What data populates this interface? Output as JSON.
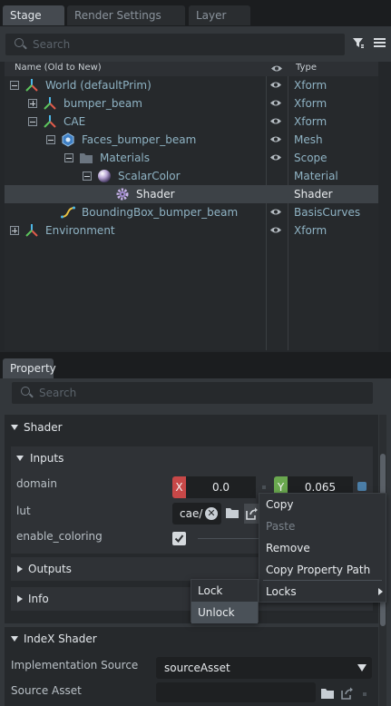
{
  "stage_panel": {
    "tabs": [
      {
        "label": "Stage",
        "active": true
      },
      {
        "label": "Render Settings",
        "active": false
      },
      {
        "label": "Layer",
        "active": false
      }
    ],
    "search_placeholder": "Search",
    "columns": {
      "name": "Name (Old to New)",
      "type": "Type"
    },
    "tree": [
      {
        "name": "World (defaultPrim)",
        "type": "Xform",
        "icon": "xform-icon",
        "expander": "minus",
        "visible": true,
        "selected": false
      },
      {
        "name": "bumper_beam",
        "type": "Xform",
        "icon": "xform-icon",
        "expander": "plus",
        "visible": true,
        "selected": false
      },
      {
        "name": "CAE",
        "type": "Xform",
        "icon": "xform-icon",
        "expander": "minus",
        "visible": true,
        "selected": false
      },
      {
        "name": "Faces_bumper_beam",
        "type": "Mesh",
        "icon": "mesh-icon",
        "expander": "minus",
        "visible": true,
        "selected": false
      },
      {
        "name": "Materials",
        "type": "Scope",
        "icon": "folder-icon",
        "expander": "minus",
        "visible": true,
        "selected": false
      },
      {
        "name": "ScalarColor",
        "type": "Material",
        "icon": "material-sphere-icon",
        "expander": "minus",
        "visible": false,
        "selected": false
      },
      {
        "name": "Shader",
        "type": "Shader",
        "icon": "shader-gear-icon",
        "expander": "none",
        "visible": false,
        "selected": true
      },
      {
        "name": "BoundingBox_bumper_beam",
        "type": "BasisCurves",
        "icon": "curve-icon",
        "expander": "none",
        "visible": true,
        "selected": false
      },
      {
        "name": "Environment",
        "type": "Xform",
        "icon": "xform-icon",
        "expander": "plus",
        "visible": true,
        "selected": false
      }
    ]
  },
  "property_panel": {
    "tab": "Property",
    "search_placeholder": "Search",
    "shader_section": "Shader",
    "inputs_section": "Inputs",
    "domain": {
      "label": "domain",
      "x_label": "X",
      "x_value": "0.0",
      "y_label": "Y",
      "y_value": "0.065"
    },
    "lut": {
      "label": "lut",
      "value": "cae/"
    },
    "enable_coloring": {
      "label": "enable_coloring",
      "checked": true
    },
    "outputs_section": "Outputs",
    "info_section": "Info",
    "index_shader_section": "IndeX Shader",
    "implementation_source": {
      "label": "Implementation Source",
      "value": "sourceAsset"
    },
    "source_asset": {
      "label": "Source Asset"
    }
  },
  "context_menu": {
    "items": [
      {
        "label": "Copy",
        "enabled": true
      },
      {
        "label": "Paste",
        "enabled": false
      },
      {
        "label": "Remove",
        "enabled": true
      },
      {
        "label": "Copy Property Path",
        "enabled": true
      },
      {
        "label": "Locks",
        "enabled": true,
        "submenu": true
      }
    ]
  },
  "locks_submenu": {
    "items": [
      {
        "label": "Lock",
        "highlighted": false
      },
      {
        "label": "Unlock",
        "highlighted": true
      }
    ]
  },
  "colors": {
    "x_axis": "#c84848",
    "y_axis": "#6aa84f",
    "selection": "#3d4247",
    "tree_text": "#8fb3c4"
  }
}
